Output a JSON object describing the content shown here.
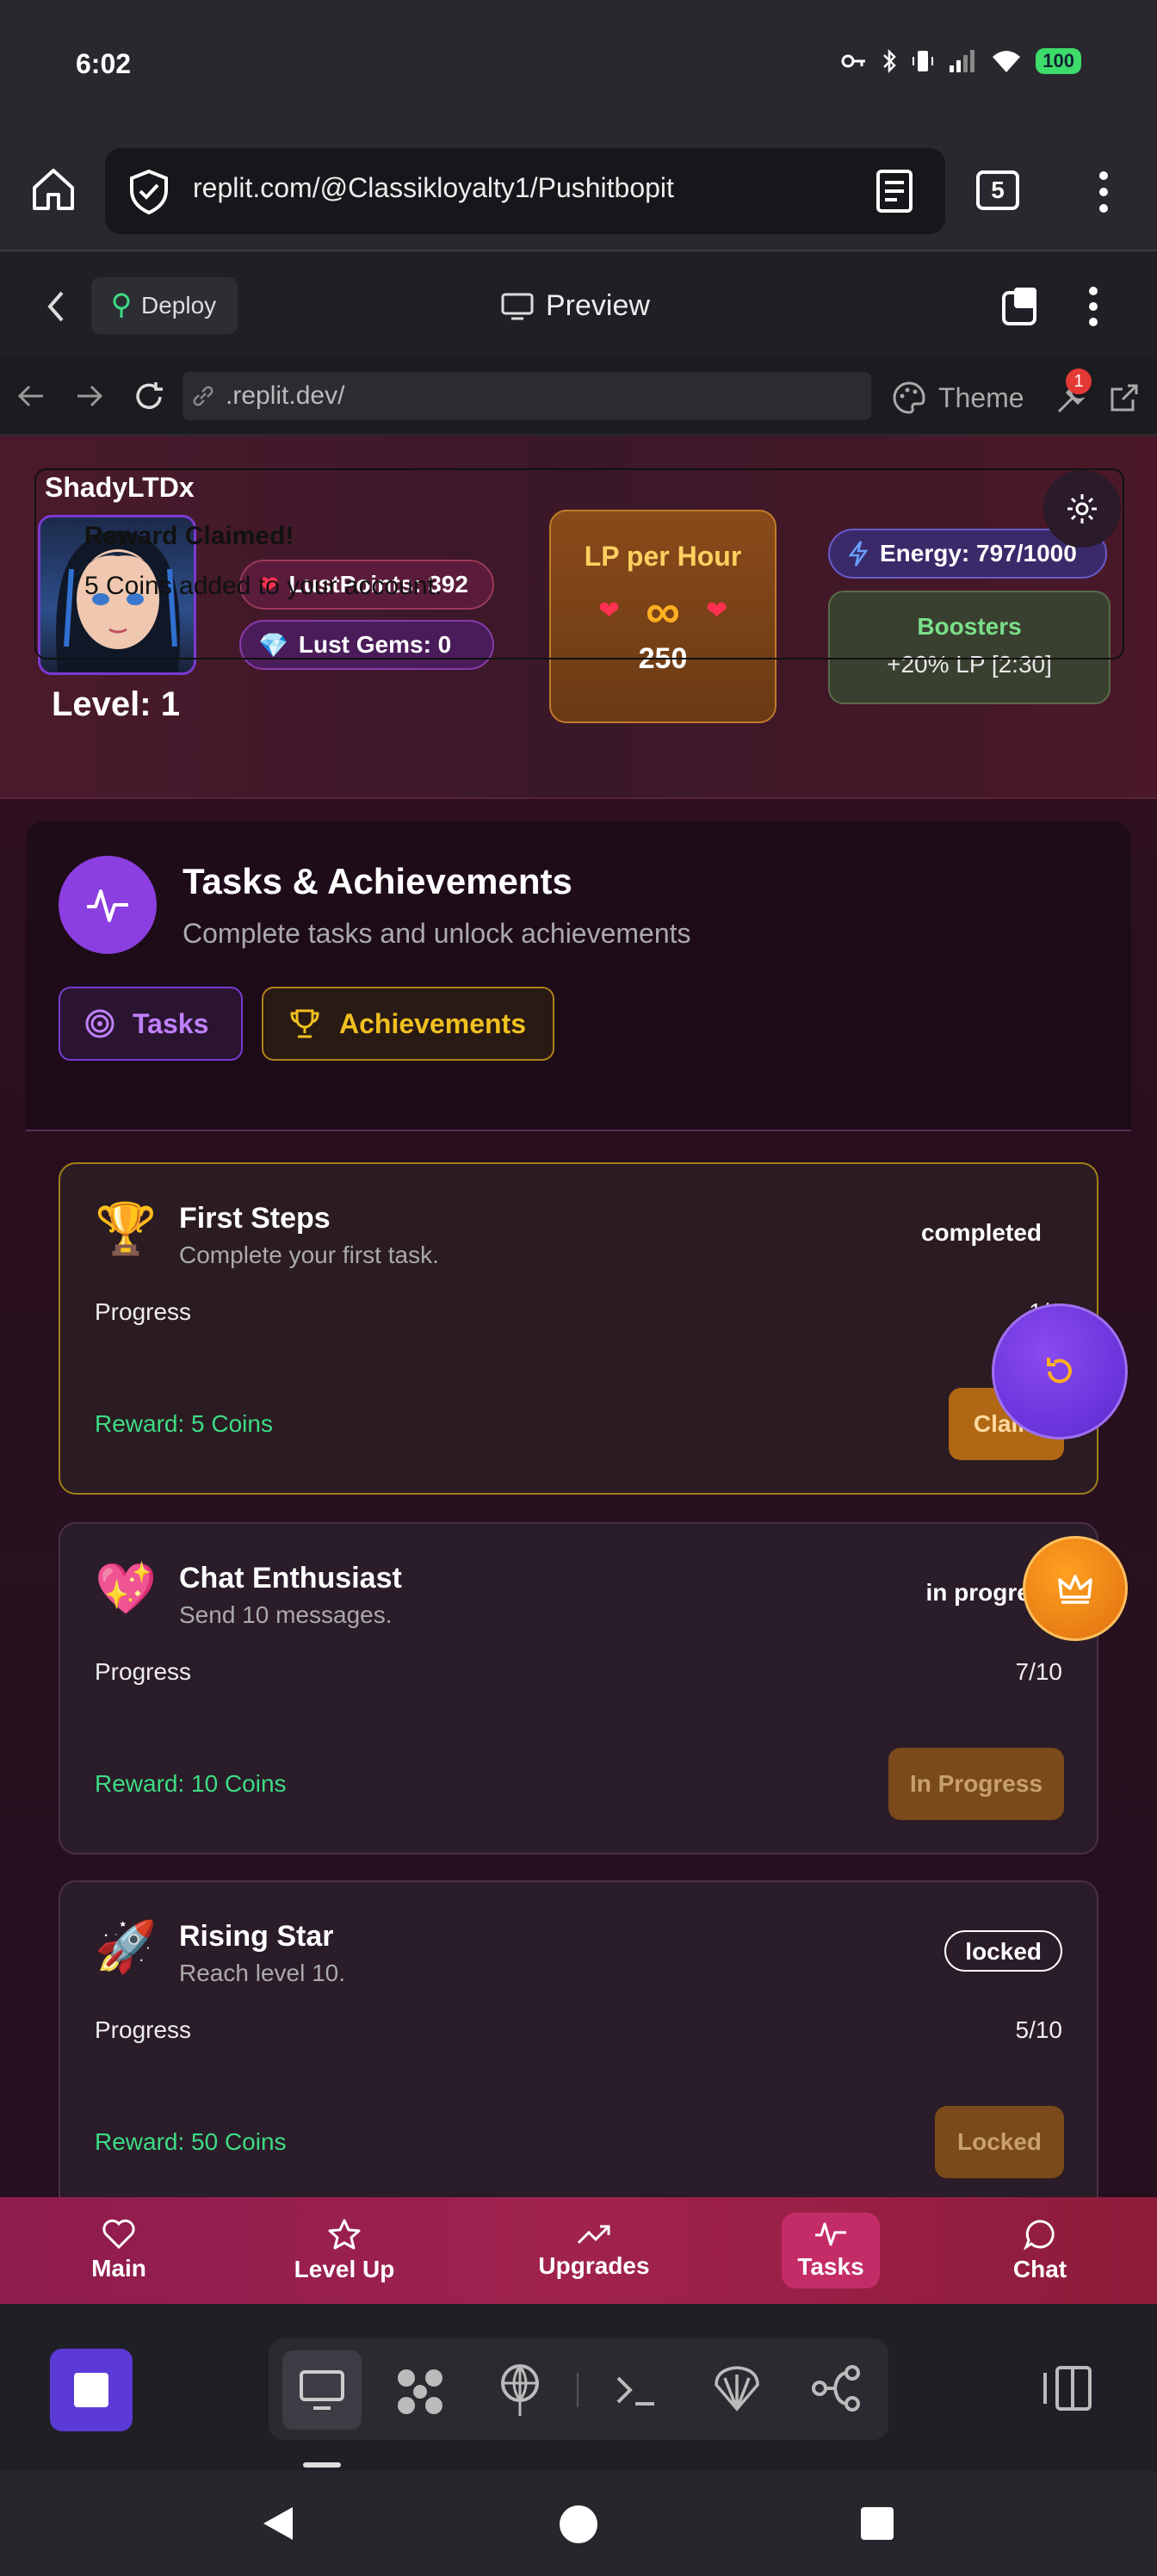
{
  "status_bar": {
    "time": "6:02",
    "battery": "100",
    "icons": [
      "key-icon",
      "bluetooth-icon",
      "vibrate-icon",
      "signal-icon",
      "wifi-icon",
      "battery-icon"
    ]
  },
  "browser": {
    "url": "replit.com/@Classikloyalty1/Pushitbopit",
    "tab_count": "5"
  },
  "replit_toolbar": {
    "deploy_label": "Deploy",
    "preview_label": "Preview"
  },
  "preview_nav": {
    "url": ".replit.dev/",
    "theme_label": "Theme",
    "notification_count": "1"
  },
  "game_header": {
    "username": "ShadyLTDx",
    "level": "Level: 1",
    "lust_points": "LustPoints: 392",
    "lust_gems": "Lust Gems: 0",
    "lp_per_hour_title": "LP per Hour",
    "lp_per_hour_symbol": "∞",
    "lp_per_hour_value": "250",
    "energy": "Energy: 797/1000",
    "boosters_title": "Boosters",
    "boosters_value": "+20% LP [2:30]"
  },
  "toast": {
    "title": "Reward Claimed!",
    "message": "5 Coins added to your account."
  },
  "tasks_section": {
    "title": "Tasks & Achievements",
    "subtitle": "Complete tasks and unlock achievements",
    "tab_tasks": "Tasks",
    "tab_achievements": "Achievements"
  },
  "tasks": [
    {
      "icon": "🏆",
      "title": "First Steps",
      "description": "Complete your first task.",
      "status": "completed",
      "progress_label": "Progress",
      "progress_value": "1/1",
      "reward": "Reward: 5 Coins",
      "button": "Claim"
    },
    {
      "icon": "💖",
      "title": "Chat Enthusiast",
      "description": "Send 10 messages.",
      "status": "in progress",
      "progress_label": "Progress",
      "progress_value": "7/10",
      "reward": "Reward: 10 Coins",
      "button": "In Progress"
    },
    {
      "icon": "🚀",
      "title": "Rising Star",
      "description": "Reach level 10.",
      "status": "locked",
      "progress_label": "Progress",
      "progress_value": "5/10",
      "reward": "Reward: 50 Coins",
      "button": "Locked"
    }
  ],
  "bottom_nav": [
    {
      "label": "Main",
      "icon": "heart-icon"
    },
    {
      "label": "Level Up",
      "icon": "star-icon"
    },
    {
      "label": "Upgrades",
      "icon": "trending-up-icon"
    },
    {
      "label": "Tasks",
      "icon": "activity-icon"
    },
    {
      "label": "Chat",
      "icon": "chat-bubble-icon"
    }
  ],
  "colors": {
    "accent_purple": "#8b3fe0",
    "accent_gold": "#e0a020",
    "reward_green": "#3ddc84",
    "nav_bar": "#a0224e"
  }
}
